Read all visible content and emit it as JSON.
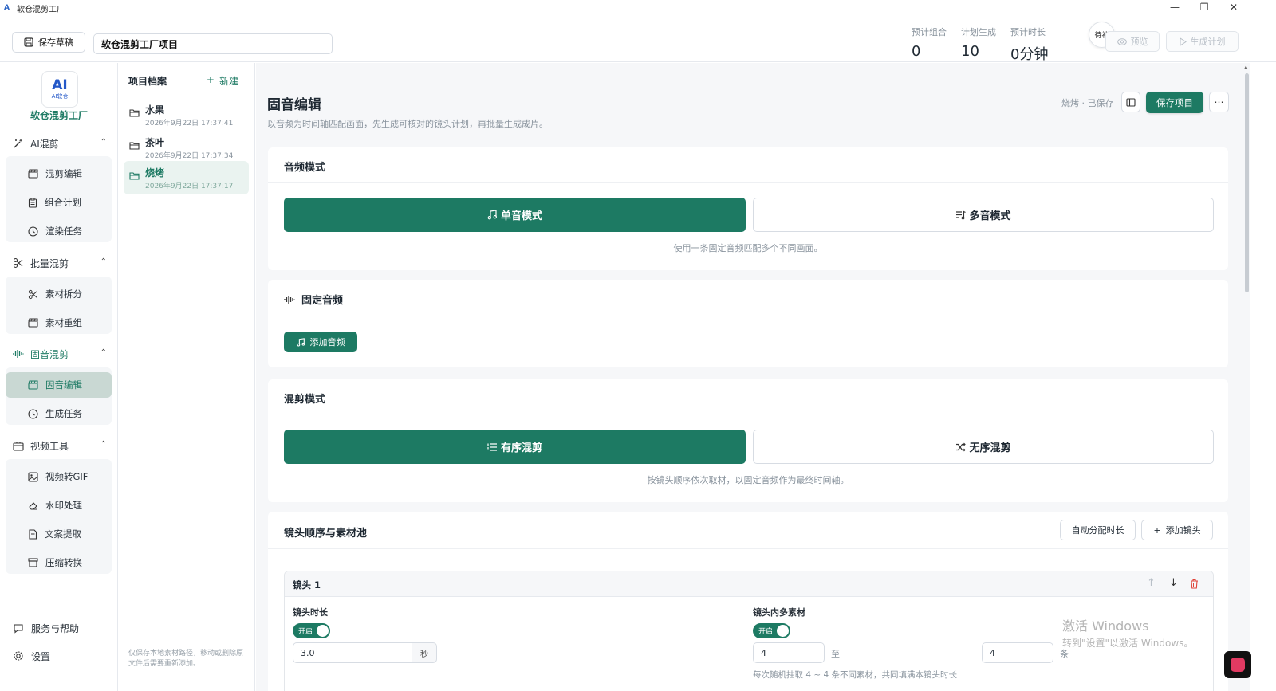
{
  "window": {
    "title": "软仓混剪工厂"
  },
  "topbar": {
    "save_draft": "保存草稿",
    "project_name": "软仓混剪工厂项目",
    "stats": [
      {
        "label": "预计组合",
        "value": "0"
      },
      {
        "label": "计划生成",
        "value": "10"
      },
      {
        "label": "预计时长",
        "value": "0分钟"
      }
    ],
    "pending": "待补",
    "preview": "预览",
    "generate_plan": "生成计划"
  },
  "brand": {
    "logo_main": "AI",
    "logo_sub": "AI软仓",
    "name": "软仓混剪工厂"
  },
  "nav": {
    "groups": [
      {
        "label": "AI混剪",
        "items": [
          "混剪编辑",
          "组合计划",
          "渲染任务"
        ]
      },
      {
        "label": "批量混剪",
        "items": [
          "素材拆分",
          "素材重组"
        ]
      },
      {
        "label": "固音混剪",
        "items": [
          "固音编辑",
          "生成任务"
        ]
      },
      {
        "label": "视频工具",
        "items": [
          "视频转GIF",
          "水印处理",
          "文案提取",
          "压缩转换"
        ]
      }
    ],
    "bottom": [
      "服务与帮助",
      "设置"
    ]
  },
  "projects": {
    "header": "项目档案",
    "new_label": "新建",
    "items": [
      {
        "name": "水果",
        "date": "2026年9月22日 17:37:41"
      },
      {
        "name": "茶叶",
        "date": "2026年9月22日 17:37:34"
      },
      {
        "name": "烧烤",
        "date": "2026年9月22日 17:37:17"
      }
    ],
    "note": "仅保存本地素材路径，移动或删除原文件后需要重新添加。"
  },
  "main": {
    "title": "固音编辑",
    "subtitle": "以音频为时间轴匹配画面，先生成可核对的镜头计划，再批量生成成片。",
    "saved_status": "烧烤 · 已保存",
    "save_project": "保存项目",
    "audio_mode": {
      "title": "音频模式",
      "single": "单音模式",
      "multi": "多音模式",
      "hint": "使用一条固定音频匹配多个不同画面。"
    },
    "fixed_audio": {
      "title": "固定音频",
      "add_button": "添加音频"
    },
    "mix_mode": {
      "title": "混剪模式",
      "ordered": "有序混剪",
      "random": "无序混剪",
      "hint": "按镜头顺序依次取材，以固定音频作为最终时间轴。"
    },
    "shots": {
      "title": "镜头顺序与素材池",
      "auto_button": "自动分配时长",
      "add_button": "添加镜头",
      "shot": {
        "title": "镜头 1",
        "duration_label": "镜头时长",
        "toggle_on": "开启",
        "duration_value": "3.0",
        "duration_unit": "秒",
        "multi_label": "镜头内多素材",
        "multi_min": "4",
        "range_sep": "至",
        "multi_max": "4",
        "multi_unit": "条",
        "multi_hint": "每次随机抽取 4 ~ 4 条不同素材，共同填满本镜头时长"
      }
    }
  },
  "watermark": {
    "line1": "激活 Windows",
    "line2": "转到\"设置\"以激活 Windows。"
  },
  "colors": {
    "accent": "#1d7a63",
    "active_bg": "#c9d8d3",
    "danger": "#e0453a"
  }
}
